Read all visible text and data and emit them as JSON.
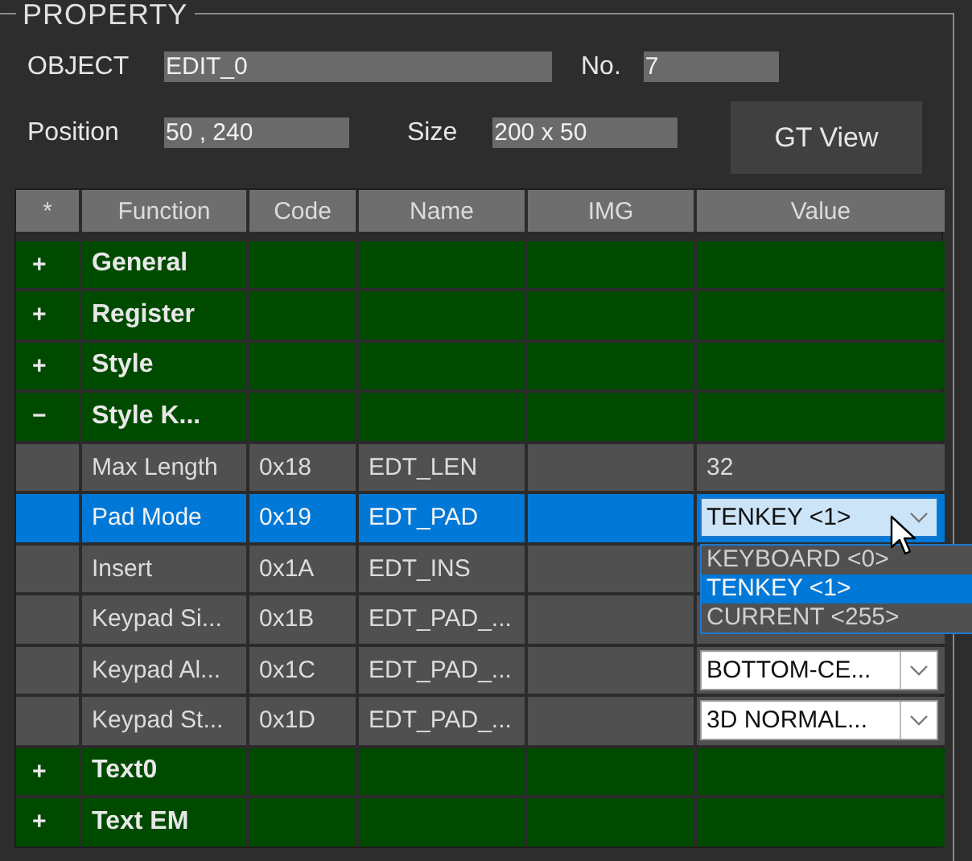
{
  "group_title": "PROPERTY",
  "form_rows": [
    [
      {
        "label": "OBJECT",
        "value": "EDIT_0"
      },
      {
        "label": "No.",
        "value": "7"
      }
    ],
    [
      {
        "label": "Position",
        "value": "50 , 240"
      },
      {
        "label": "Size",
        "value": "200 x 50"
      }
    ]
  ],
  "gt_view_button": "GT View",
  "table": {
    "columns": [
      "*",
      "Function",
      "Code",
      "Name",
      "IMG",
      "Value"
    ],
    "rows": [
      {
        "kind": "group",
        "expander": "+",
        "function": "General"
      },
      {
        "kind": "group",
        "expander": "+",
        "function": "Register"
      },
      {
        "kind": "group",
        "expander": "+",
        "function": "Style"
      },
      {
        "kind": "group",
        "expander": "−",
        "function": "Style K..."
      },
      {
        "kind": "item",
        "selected": false,
        "function": "Max Length",
        "code": "0x18",
        "name": "EDT_LEN",
        "value": {
          "kind": "text",
          "text": "32"
        }
      },
      {
        "kind": "item",
        "selected": true,
        "function": "Pad Mode",
        "code": "0x19",
        "name": "EDT_PAD",
        "value": {
          "kind": "dropdown",
          "text": "TENKEY <1>",
          "open": true,
          "options": [
            {
              "label": "KEYBOARD <0>",
              "selected": false
            },
            {
              "label": "TENKEY <1>",
              "selected": true
            },
            {
              "label": "CURRENT <255>",
              "selected": false
            }
          ]
        }
      },
      {
        "kind": "item",
        "selected": false,
        "function": "Insert",
        "code": "0x1A",
        "name": "EDT_INS"
      },
      {
        "kind": "item",
        "selected": false,
        "function": "Keypad Si...",
        "code": "0x1B",
        "name": "EDT_PAD_..."
      },
      {
        "kind": "item",
        "selected": false,
        "function": "Keypad Al...",
        "code": "0x1C",
        "name": "EDT_PAD_...",
        "value": {
          "kind": "dropdown",
          "text": "BOTTOM-CE...",
          "open": false
        }
      },
      {
        "kind": "item",
        "selected": false,
        "function": "Keypad St...",
        "code": "0x1D",
        "name": "EDT_PAD_...",
        "value": {
          "kind": "dropdown",
          "text": "3D NORMAL...",
          "open": false
        }
      },
      {
        "kind": "group",
        "expander": "+",
        "function": "Text0"
      },
      {
        "kind": "group",
        "expander": "+",
        "function": "Text EM"
      }
    ]
  }
}
